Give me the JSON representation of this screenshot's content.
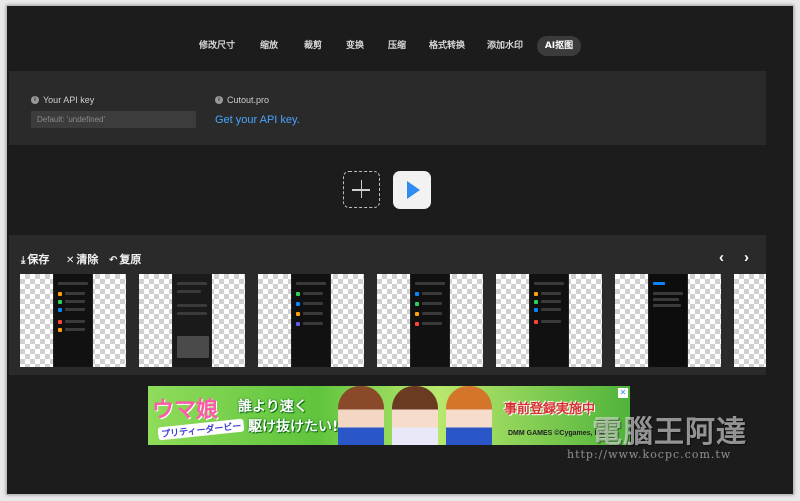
{
  "nav": {
    "items": [
      "修改尺寸",
      "缩放",
      "裁剪",
      "变换",
      "压缩",
      "格式转换",
      "添加水印",
      "AI抠图"
    ],
    "active": "AI抠图"
  },
  "api": {
    "key_label": "Your API key",
    "key_placeholder": "Default: 'undefined'",
    "provider_label": "Cutout.pro",
    "link_text": "Get your API key."
  },
  "toolbar": {
    "save_label": "保存",
    "clear_label": "清除",
    "restore_label": "复原"
  },
  "results": {
    "thumbnail_count": 7
  },
  "ad": {
    "logo_text": "ウマ娘",
    "logo_sub": "プリティーダービー",
    "copy_line1": "誰より速く",
    "copy_line2": "駆け抜けたい!",
    "tagline": "事前登録実施中",
    "brand": "DMM GAMES  ©Cygames, Inc."
  },
  "watermark": {
    "text": "電腦王阿達",
    "url": "http://www.kocpc.com.tw"
  },
  "colors": {
    "background": "#1c1c1c",
    "panel": "#2a2a2a",
    "link": "#4aa3ff",
    "play": "#2f8cf2"
  }
}
